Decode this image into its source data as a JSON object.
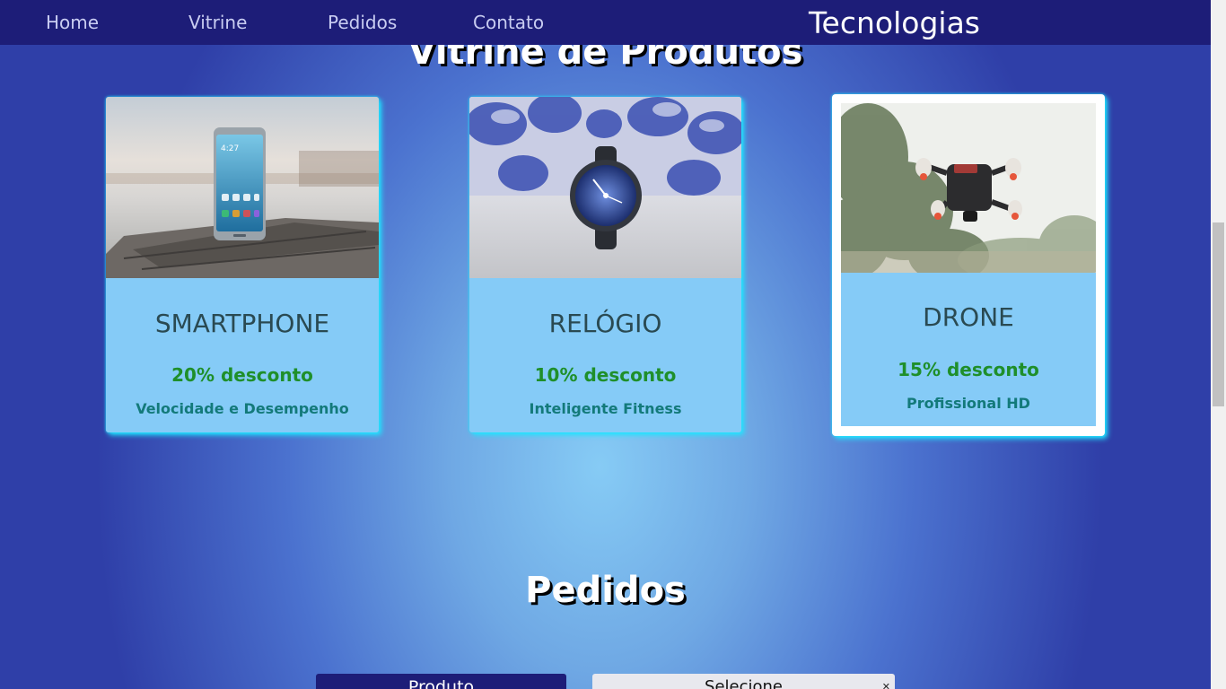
{
  "nav": {
    "links": [
      "Home",
      "Vitrine",
      "Pedidos",
      "Contato"
    ],
    "brand": "Tecnologias",
    "colors": {
      "bar": "#1d1d78",
      "link": "#c9cdf2"
    }
  },
  "vitrine": {
    "title": "Vitrine de Produtos",
    "products": [
      {
        "name": "SMARTPHONE",
        "discount": "20% desconto",
        "description": "Velocidade e Desempenho",
        "icon": "smartphone-photo"
      },
      {
        "name": "RELÓGIO",
        "discount": "10% desconto",
        "description": "Inteligente Fitness",
        "icon": "smartwatch-photo"
      },
      {
        "name": "DRONE",
        "discount": "15% desconto",
        "description": "Profissional HD",
        "icon": "drone-photo"
      }
    ],
    "colors": {
      "card": "#85cbf7",
      "glow": "#20e4ff",
      "name": "#2a4a52",
      "discount": "#1f8f2a",
      "description": "#137a7a"
    }
  },
  "pedidos": {
    "title": "Pedidos",
    "produto_label": "Produto",
    "select": {
      "selected": "Selecione"
    }
  }
}
